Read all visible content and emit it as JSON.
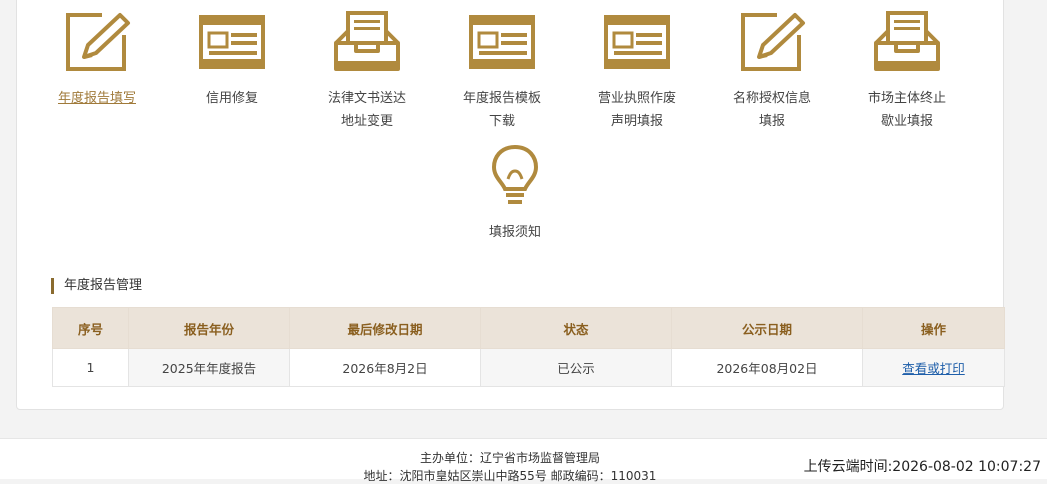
{
  "menu": {
    "items": [
      {
        "label": "年度报告填写",
        "active": true,
        "icon": "edit-icon"
      },
      {
        "label": "信用修复",
        "icon": "window-form-icon"
      },
      {
        "label": "法律文书送达\n地址变更",
        "icon": "inbox-tray-icon"
      },
      {
        "label": "年度报告模板\n下载",
        "icon": "window-form-icon"
      },
      {
        "label": "营业执照作废\n声明填报",
        "icon": "window-form-icon"
      },
      {
        "label": "名称授权信息\n填报",
        "icon": "edit-icon"
      },
      {
        "label": "市场主体终止\n歇业填报",
        "icon": "inbox-tray-icon"
      },
      {
        "label": "填报须知",
        "icon": "lightbulb-icon"
      }
    ]
  },
  "section": {
    "title": "年度报告管理"
  },
  "table": {
    "headers": [
      "序号",
      "报告年份",
      "最后修改日期",
      "状态",
      "公示日期",
      "操作"
    ],
    "rows": [
      {
        "no": "1",
        "year": "2025年年度报告",
        "modified": "2026年8月2日",
        "status": "已公示",
        "published": "2026年08月02日",
        "action": "查看或打印"
      }
    ]
  },
  "footer": {
    "sponsor": "主办单位：辽宁省市场监督管理局",
    "address": "地址：沈阳市皇姑区崇山中路55号 邮政编码：110031",
    "upload_time": "上传云端时间:2026-08-02 10:07:27"
  },
  "colors": {
    "accent": "#b08a3e",
    "header_bg": "#ebe3d9",
    "link": "#1f5faa"
  }
}
